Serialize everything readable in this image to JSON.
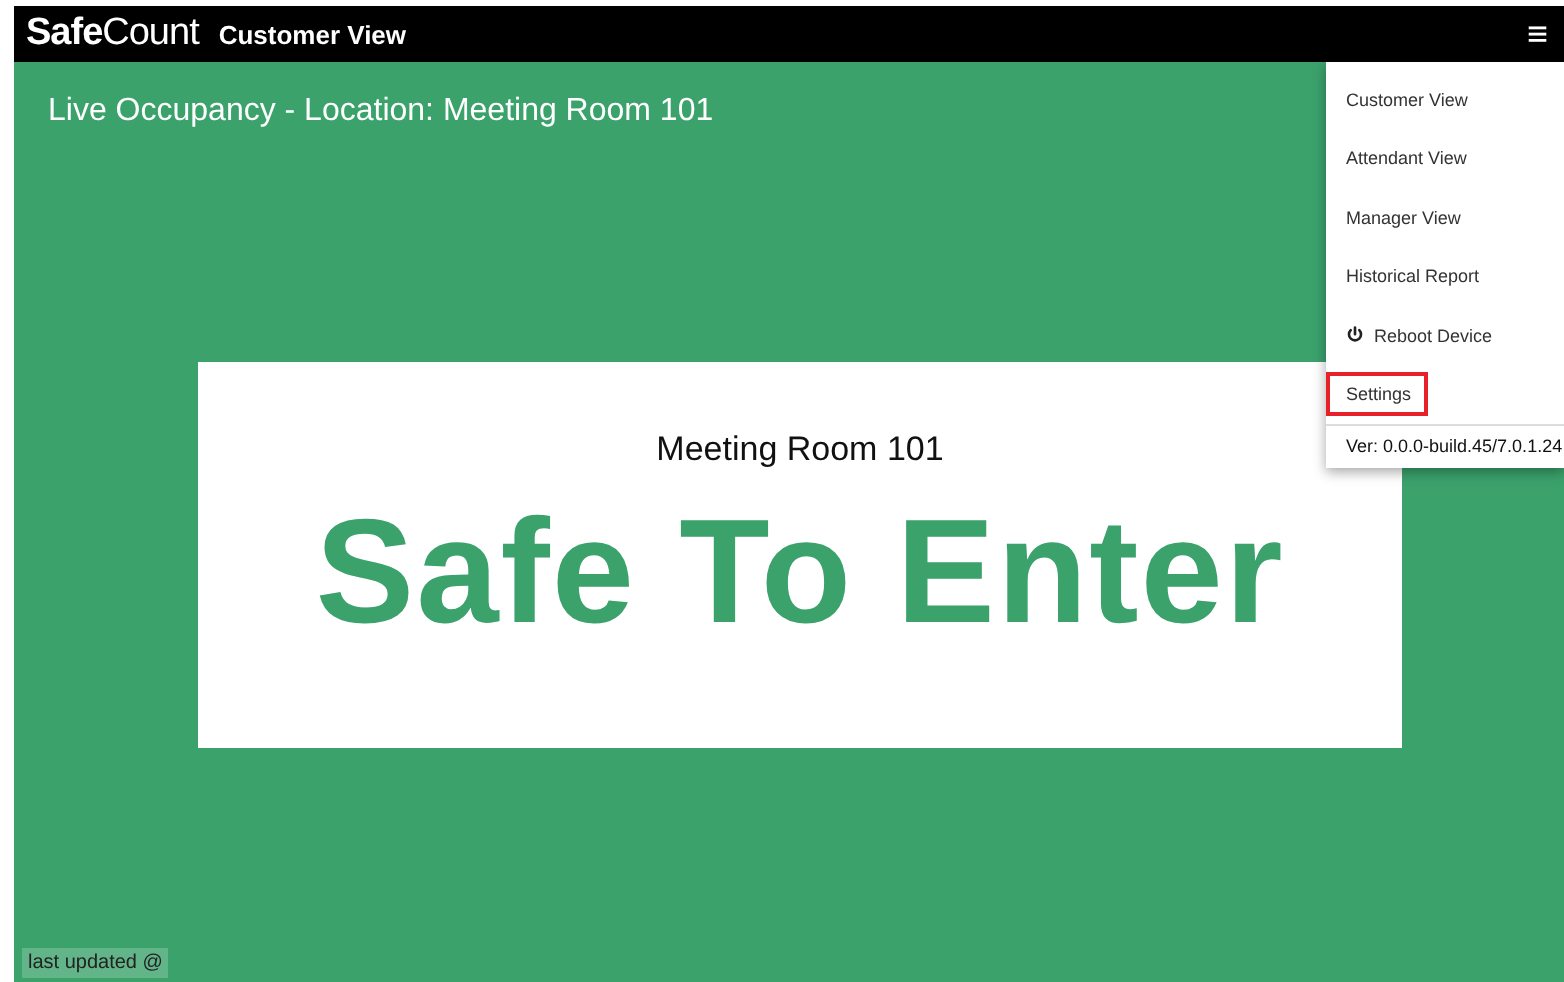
{
  "header": {
    "logo": "**Safe**Count",
    "title": "Customer View",
    "menu_icon": "≡"
  },
  "page": {
    "heading": "Live Occupancy - Location: Meeting Room 101"
  },
  "status_card": {
    "location": "Meeting Room 101",
    "status": "Safe To Enter"
  },
  "footer": {
    "label": "last updated @"
  },
  "menu": {
    "items": [
      {
        "label": "Customer View",
        "kind": "item",
        "highlighted": false
      },
      {
        "label": "Attendant View",
        "kind": "item",
        "highlighted": false
      },
      {
        "label": "Manager View",
        "kind": "item",
        "highlighted": false
      },
      {
        "label": "Historical Report",
        "kind": "item",
        "highlighted": false
      },
      {
        "label": "Reboot Device",
        "kind": "power",
        "highlighted": false
      },
      {
        "label": "Settings",
        "kind": "item",
        "highlighted": true
      }
    ],
    "version": "Ver: 0.0.0-build.45/7.0.1.24"
  }
}
